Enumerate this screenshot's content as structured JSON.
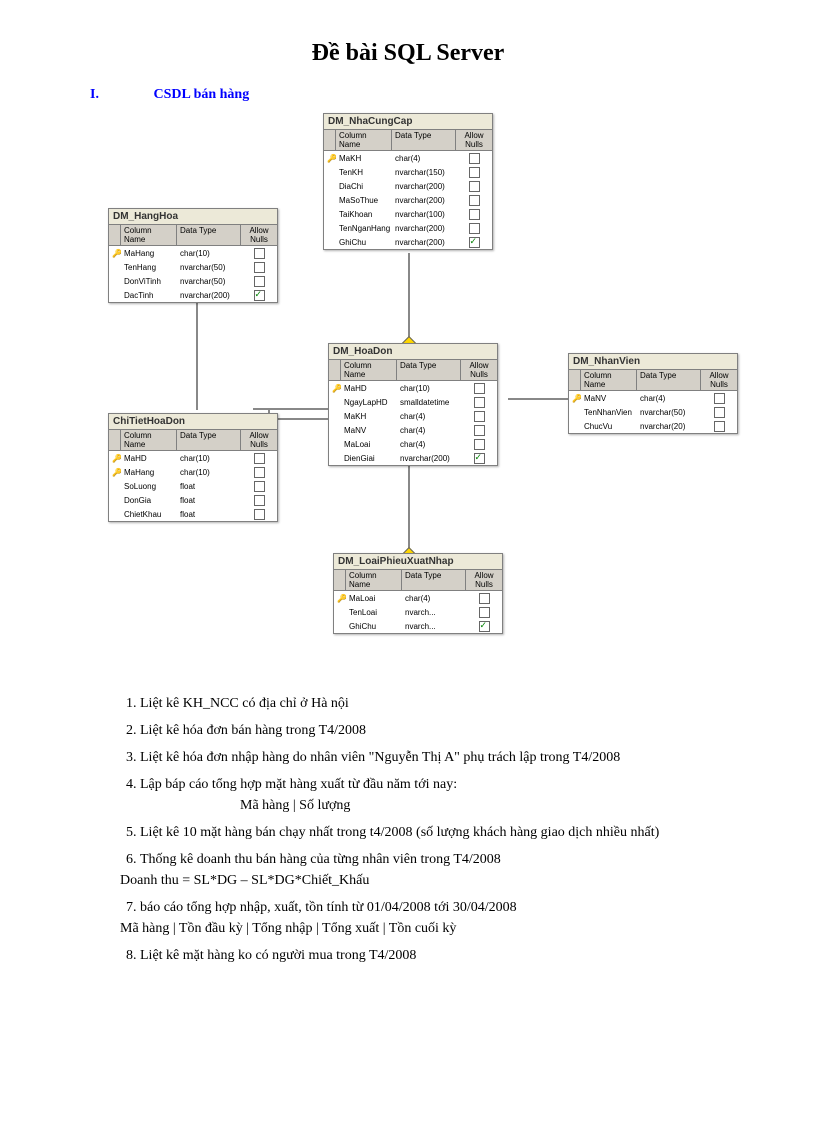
{
  "title": "Đề bài SQL Server",
  "section": {
    "roman": "I.",
    "name": "CSDL bán hàng"
  },
  "headers": {
    "colname": "Column Name",
    "datatype": "Data Type",
    "allownulls": "Allow Nulls"
  },
  "tables": {
    "nhacungcap": {
      "title": "DM_NhaCungCap",
      "rows": [
        {
          "key": true,
          "name": "MaKH",
          "type": "char(4)",
          "null": false
        },
        {
          "key": false,
          "name": "TenKH",
          "type": "nvarchar(150)",
          "null": false
        },
        {
          "key": false,
          "name": "DiaChi",
          "type": "nvarchar(200)",
          "null": false
        },
        {
          "key": false,
          "name": "MaSoThue",
          "type": "nvarchar(200)",
          "null": false
        },
        {
          "key": false,
          "name": "TaiKhoan",
          "type": "nvarchar(100)",
          "null": false
        },
        {
          "key": false,
          "name": "TenNganHang",
          "type": "nvarchar(200)",
          "null": false
        },
        {
          "key": false,
          "name": "GhiChu",
          "type": "nvarchar(200)",
          "null": true
        }
      ]
    },
    "hanghoa": {
      "title": "DM_HangHoa",
      "rows": [
        {
          "key": true,
          "name": "MaHang",
          "type": "char(10)",
          "null": false
        },
        {
          "key": false,
          "name": "TenHang",
          "type": "nvarchar(50)",
          "null": false
        },
        {
          "key": false,
          "name": "DonViTinh",
          "type": "nvarchar(50)",
          "null": false
        },
        {
          "key": false,
          "name": "DacTinh",
          "type": "nvarchar(200)",
          "null": true
        }
      ]
    },
    "hoadon": {
      "title": "DM_HoaDon",
      "rows": [
        {
          "key": true,
          "name": "MaHD",
          "type": "char(10)",
          "null": false
        },
        {
          "key": false,
          "name": "NgayLapHD",
          "type": "smalldatetime",
          "null": false
        },
        {
          "key": false,
          "name": "MaKH",
          "type": "char(4)",
          "null": false
        },
        {
          "key": false,
          "name": "MaNV",
          "type": "char(4)",
          "null": false
        },
        {
          "key": false,
          "name": "MaLoai",
          "type": "char(4)",
          "null": false
        },
        {
          "key": false,
          "name": "DienGiai",
          "type": "nvarchar(200)",
          "null": true
        }
      ]
    },
    "nhanvien": {
      "title": "DM_NhanVien",
      "rows": [
        {
          "key": true,
          "name": "MaNV",
          "type": "char(4)",
          "null": false
        },
        {
          "key": false,
          "name": "TenNhanVien",
          "type": "nvarchar(50)",
          "null": false
        },
        {
          "key": false,
          "name": "ChucVu",
          "type": "nvarchar(20)",
          "null": false
        }
      ]
    },
    "chitiethoadon": {
      "title": "ChiTietHoaDon",
      "rows": [
        {
          "key": true,
          "name": "MaHD",
          "type": "char(10)",
          "null": false
        },
        {
          "key": true,
          "name": "MaHang",
          "type": "char(10)",
          "null": false
        },
        {
          "key": false,
          "name": "SoLuong",
          "type": "float",
          "null": false
        },
        {
          "key": false,
          "name": "DonGia",
          "type": "float",
          "null": false
        },
        {
          "key": false,
          "name": "ChietKhau",
          "type": "float",
          "null": false
        }
      ]
    },
    "loaiphieu": {
      "title": "DM_LoaiPhieuXuatNhap",
      "rows": [
        {
          "key": true,
          "name": "MaLoai",
          "type": "char(4)",
          "null": false
        },
        {
          "key": false,
          "name": "TenLoai",
          "type": "nvarch...",
          "null": false
        },
        {
          "key": false,
          "name": "GhiChu",
          "type": "nvarch...",
          "null": true
        }
      ]
    }
  },
  "questions": [
    "Liệt kê KH_NCC có địa chỉ ở Hà nội",
    "Liệt kê hóa đơn bán hàng trong T4/2008",
    "Liệt kê hóa đơn nhập hàng do nhân viên \"Nguyễn Thị A\" phụ trách lập trong T4/2008",
    "Lập báp cáo tổng hợp mặt hàng xuất từ đầu năm tới nay:",
    "Liệt kê 10 mặt hàng bán chạy nhất trong t4/2008 (số lượng khách hàng giao dịch nhiều nhất)",
    "Thống kê doanh thu bán hàng của từng nhân viên trong T4/2008",
    "báo cáo tổng hợp nhập, xuất, tồn tính từ 01/04/2008 tới 30/04/2008",
    "Liệt kê mặt hàng ko có người mua trong T4/2008"
  ],
  "extras": {
    "q4_sub": "Mã hàng |   Số lượng",
    "q6_sub": "Doanh thu = SL*DG – SL*DG*Chiết_Khấu",
    "q7_sub": "Mã hàng | Tồn đầu kỳ | Tổng nhập | Tổng xuất | Tồn cuối kỳ"
  }
}
